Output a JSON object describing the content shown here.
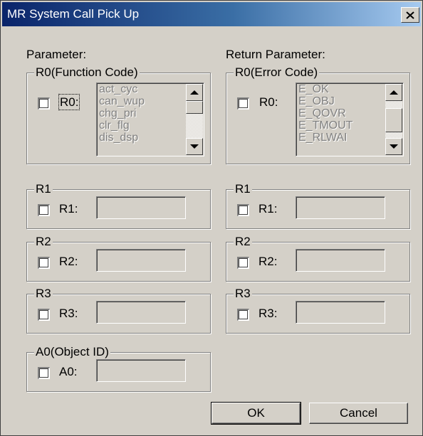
{
  "window": {
    "title": "MR System Call Pick Up",
    "close_icon": "close-icon"
  },
  "parameter": {
    "heading": "Parameter:",
    "r0": {
      "caption": "R0(Function Code)",
      "label": "R0:",
      "checked": false,
      "items": [
        "act_cyc",
        "can_wup",
        "chg_pri",
        "clr_flg",
        "dis_dsp"
      ]
    },
    "r1": {
      "caption": "R1",
      "label": "R1:",
      "value": "",
      "checked": false
    },
    "r2": {
      "caption": "R2",
      "label": "R2:",
      "value": "",
      "checked": false
    },
    "r3": {
      "caption": "R3",
      "label": "R3:",
      "value": "",
      "checked": false
    },
    "a0": {
      "caption": "A0(Object ID)",
      "label": "A0:",
      "value": "",
      "checked": false
    }
  },
  "return_parameter": {
    "heading": "Return Parameter:",
    "r0": {
      "caption": "R0(Error Code)",
      "label": "R0:",
      "checked": false,
      "items": [
        "E_OK",
        "E_OBJ",
        "E_QOVR",
        "E_TMOUT",
        "E_RLWAI"
      ]
    },
    "r1": {
      "caption": "R1",
      "label": "R1:",
      "value": "",
      "checked": false
    },
    "r2": {
      "caption": "R2",
      "label": "R2:",
      "value": "",
      "checked": false
    },
    "r3": {
      "caption": "R3",
      "label": "R3:",
      "value": "",
      "checked": false
    }
  },
  "buttons": {
    "ok": "OK",
    "cancel": "Cancel"
  }
}
